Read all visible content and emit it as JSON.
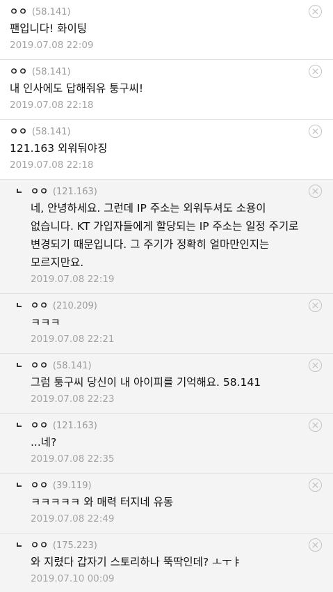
{
  "comments": [
    {
      "type": "top",
      "nick": "ㅇㅇ",
      "ip": "(58.141)",
      "text": "팬입니다! 화이팅",
      "date": "2019.07.08 22:09"
    },
    {
      "type": "top",
      "nick": "ㅇㅇ",
      "ip": "(58.141)",
      "text": "내 인사에도 답해줘유 퉁구씨!",
      "date": "2019.07.08 22:18"
    },
    {
      "type": "top",
      "nick": "ㅇㅇ",
      "ip": "(58.141)",
      "text": "121.163 외워둬야징",
      "date": "2019.07.08 22:18"
    },
    {
      "type": "reply",
      "nick": "ㅇㅇ",
      "ip": "(121.163)",
      "text": "네, 안녕하세요. 그런데 IP 주소는 외워두셔도 소용이 없습니다. KT 가입자들에게 할당되는 IP 주소는 일정 주기로 변경되기 때문입니다. 그 주기가 정확히 얼마만인지는 모르지만요.",
      "date": "2019.07.08 22:19"
    },
    {
      "type": "reply",
      "nick": "ㅇㅇ",
      "ip": "(210.209)",
      "text": "ㅋㅋㅋ",
      "date": "2019.07.08 22:21"
    },
    {
      "type": "reply",
      "nick": "ㅇㅇ",
      "ip": "(58.141)",
      "text": "그럼 퉁구씨 당신이 내 아이피를 기억해요. 58.141",
      "date": "2019.07.08 22:23"
    },
    {
      "type": "reply",
      "nick": "ㅇㅇ",
      "ip": "(121.163)",
      "text": "...네?",
      "date": "2019.07.08 22:35"
    },
    {
      "type": "reply",
      "nick": "ㅇㅇ",
      "ip": "(39.119)",
      "text": "ㅋㅋㅋㅋㅋ 와 매력 터지네 유동",
      "date": "2019.07.08 22:49"
    },
    {
      "type": "reply",
      "nick": "ㅇㅇ",
      "ip": "(175.223)",
      "text": "와 지렸다 갑자기 스토리하나 뚝딱인데? ㅗㅜㅑ",
      "date": "2019.07.10 00:09"
    }
  ],
  "icons": {
    "delete": "close-circle-icon",
    "reply": "reply-arrow-icon"
  }
}
